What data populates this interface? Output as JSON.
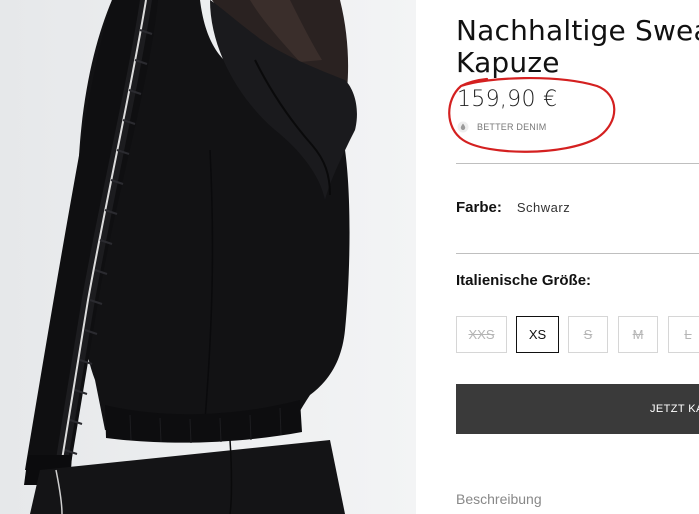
{
  "product": {
    "title_line1": "Nachhaltige Sweat",
    "title_line2": "Kapuze",
    "price": "159,90 €",
    "badge_label": "BETTER DENIM",
    "badge_icon": "drop-icon"
  },
  "color": {
    "label": "Farbe:",
    "value": "Schwarz"
  },
  "size": {
    "label": "Italienische Größe:",
    "options": [
      "XXS",
      "XS",
      "S",
      "M",
      "L"
    ],
    "selected": "XS"
  },
  "actions": {
    "buy_label": "JETZT KA"
  },
  "tabs": {
    "description_label": "Beschreibung"
  },
  "colors": {
    "annotation": "#d42020",
    "buy_button": "#3a3a3a",
    "garment": "#121214"
  }
}
